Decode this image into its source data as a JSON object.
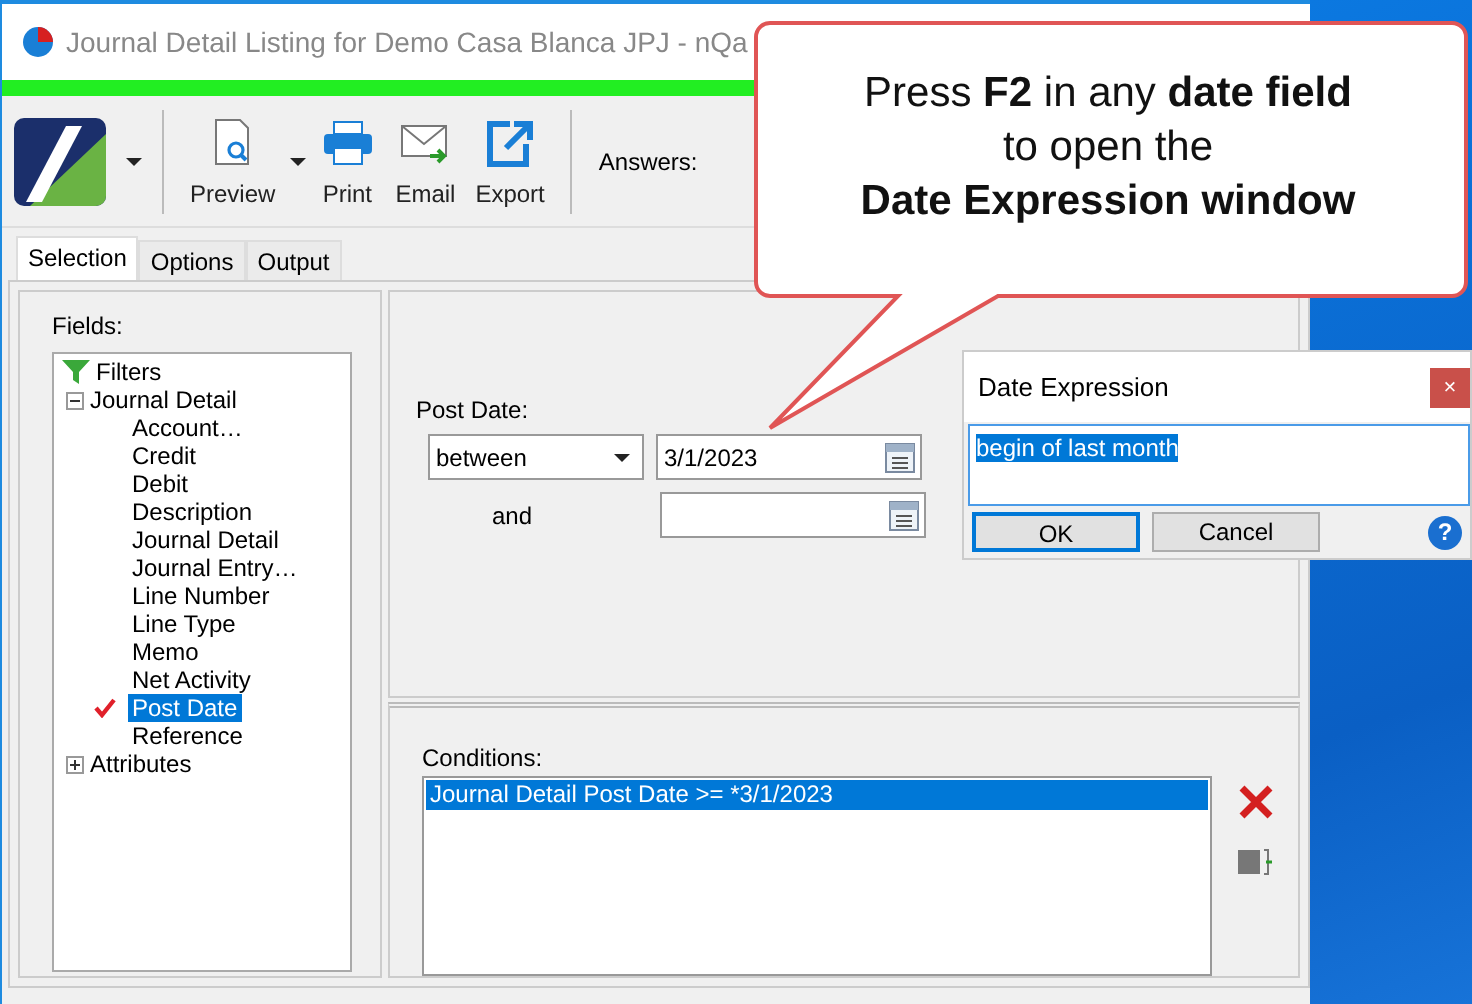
{
  "window": {
    "title": "Journal Detail Listing for Demo Casa Blanca JPJ - nQa"
  },
  "toolbar": {
    "buttons": [
      {
        "label": "Preview",
        "kind": "preview",
        "dropdown": true
      },
      {
        "label": "Print",
        "kind": "print",
        "dropdown": false
      },
      {
        "label": "Email",
        "kind": "email",
        "dropdown": false
      },
      {
        "label": "Export",
        "kind": "export",
        "dropdown": false
      }
    ],
    "answers_label": "Answers:"
  },
  "tabs": [
    {
      "label": "Selection",
      "selected": true
    },
    {
      "label": "Options",
      "selected": false
    },
    {
      "label": "Output",
      "selected": false
    }
  ],
  "fields": {
    "label": "Fields:",
    "tree": [
      {
        "label": "Filters",
        "kind": "filter"
      },
      {
        "label": "Journal Detail",
        "kind": "group",
        "expanded": true,
        "children": [
          {
            "label": "Account…",
            "checked": false,
            "selected": false
          },
          {
            "label": "Credit",
            "checked": false,
            "selected": false
          },
          {
            "label": "Debit",
            "checked": false,
            "selected": false
          },
          {
            "label": "Description",
            "checked": false,
            "selected": false
          },
          {
            "label": "Journal Detail",
            "checked": false,
            "selected": false
          },
          {
            "label": "Journal Entry…",
            "checked": false,
            "selected": false
          },
          {
            "label": "Line Number",
            "checked": false,
            "selected": false
          },
          {
            "label": "Line Type",
            "checked": false,
            "selected": false
          },
          {
            "label": "Memo",
            "checked": false,
            "selected": false
          },
          {
            "label": "Net Activity",
            "checked": false,
            "selected": false
          },
          {
            "label": "Post Date",
            "checked": true,
            "selected": true
          },
          {
            "label": "Reference",
            "checked": false,
            "selected": false
          }
        ]
      },
      {
        "label": "Attributes",
        "kind": "group",
        "expanded": false
      }
    ]
  },
  "post_date": {
    "label": "Post Date:",
    "operator": "between",
    "from": "3/1/2023",
    "and_label": "and"
  },
  "conditions": {
    "label": "Conditions:",
    "items": [
      {
        "text": "Journal Detail Post Date >= *3/1/2023",
        "selected": true
      }
    ]
  },
  "date_expression_dialog": {
    "title": "Date Expression",
    "close": "×",
    "expression": "begin of last month",
    "buttons": [
      "OK",
      "Cancel"
    ],
    "help": "?"
  },
  "callout": {
    "lines": [
      "Press **F2** in any **date field**",
      "to open the",
      "**Date Expression window**"
    ]
  }
}
